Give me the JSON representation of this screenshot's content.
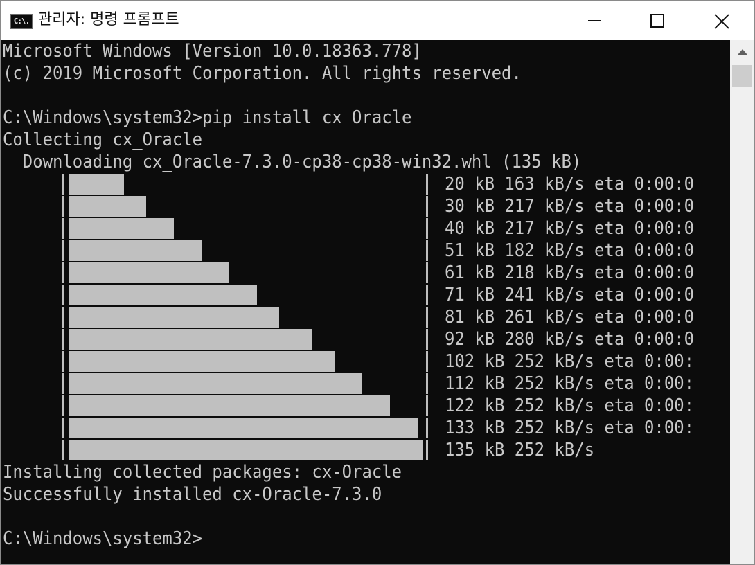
{
  "window": {
    "title": "관리자: 명령 프롬프트",
    "icon_label": "C:\\."
  },
  "controls": {
    "minimize": "minimize",
    "maximize": "maximize",
    "close": "close"
  },
  "console": {
    "lines_top": [
      "Microsoft Windows [Version 10.0.18363.778]",
      "(c) 2019 Microsoft Corporation. All rights reserved.",
      "",
      "C:\\Windows\\system32>pip install cx_Oracle",
      "Collecting cx_Oracle",
      "  Downloading cx_Oracle-7.3.0-cp38-cp38-win32.whl (135 kB)"
    ],
    "progress": [
      {
        "fraction": 0.156,
        "stat": "20 kB 163 kB/s eta 0:00:0"
      },
      {
        "fraction": 0.219,
        "stat": "30 kB 217 kB/s eta 0:00:0"
      },
      {
        "fraction": 0.297,
        "stat": "40 kB 217 kB/s eta 0:00:0"
      },
      {
        "fraction": 0.375,
        "stat": "51 kB 182 kB/s eta 0:00:0"
      },
      {
        "fraction": 0.453,
        "stat": "61 kB 218 kB/s eta 0:00:0"
      },
      {
        "fraction": 0.531,
        "stat": "71 kB 241 kB/s eta 0:00:0"
      },
      {
        "fraction": 0.594,
        "stat": "81 kB 261 kB/s eta 0:00:0"
      },
      {
        "fraction": 0.688,
        "stat": "92 kB 280 kB/s eta 0:00:0"
      },
      {
        "fraction": 0.75,
        "stat": "102 kB 252 kB/s eta 0:00:"
      },
      {
        "fraction": 0.828,
        "stat": "112 kB 252 kB/s eta 0:00:"
      },
      {
        "fraction": 0.906,
        "stat": "122 kB 252 kB/s eta 0:00:"
      },
      {
        "fraction": 0.984,
        "stat": "133 kB 252 kB/s eta 0:00:"
      },
      {
        "fraction": 1.0,
        "stat": "135 kB 252 kB/s"
      }
    ],
    "lines_bottom": [
      "Installing collected packages: cx-Oracle",
      "Successfully installed cx-Oracle-7.3.0",
      "",
      "C:\\Windows\\system32>"
    ]
  },
  "colors": {
    "console_bg": "#0c0c0c",
    "console_text": "#c8c8c8",
    "bar": "#c0c0c0",
    "titlebar_bg": "#ffffff"
  }
}
